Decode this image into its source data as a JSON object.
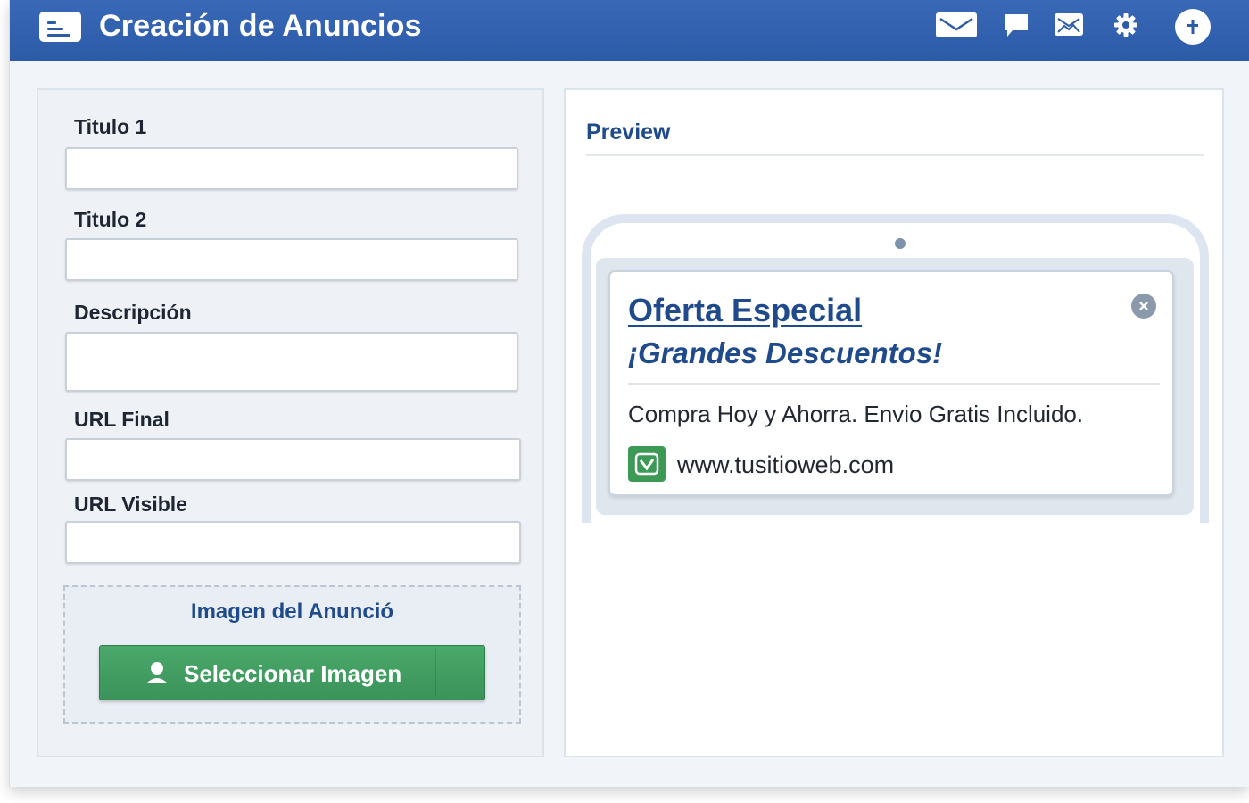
{
  "app": {
    "title": "Creación de Anuncios",
    "accent_color": "#2c5ba8"
  },
  "toolbar": {
    "icons": [
      "mail-icon",
      "chat-icon",
      "image-mail-icon",
      "gear-icon",
      "add-icon"
    ]
  },
  "form": {
    "fields": [
      {
        "label": "Titulo 1",
        "value": ""
      },
      {
        "label": "Titulo 2",
        "value": ""
      },
      {
        "label": "Descripción",
        "value": ""
      },
      {
        "label": "URL Final",
        "value": ""
      },
      {
        "label": "URL Visible",
        "value": ""
      }
    ],
    "image_section": {
      "title": "Imagen del Anunció",
      "button_label": "Seleccionar Imagen",
      "button_color": "#3f9d5f"
    }
  },
  "preview": {
    "title": "Preview",
    "ad": {
      "headline": "Oferta Especial",
      "subheadline": "¡Grandes Descuentos!",
      "description": "Compra Hoy y Ahorra. Envio Gratis Incluido.",
      "display_url": "www.tusitioweb.com"
    }
  }
}
